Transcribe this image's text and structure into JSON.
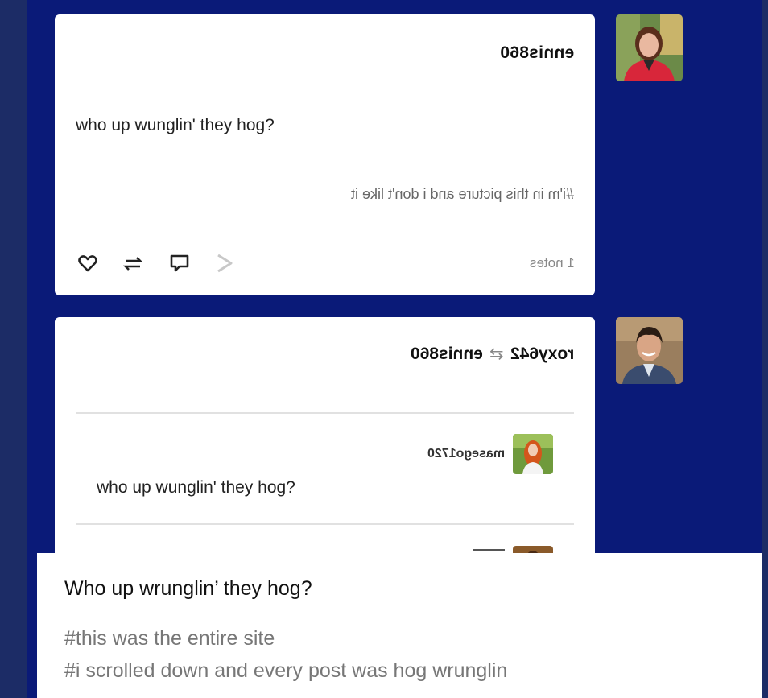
{
  "post1": {
    "username": "ennis860",
    "body": "who up wunglin' they hog?",
    "tags": "#i'm in this picture and i don't like it",
    "notes": "1 notes"
  },
  "post2": {
    "username": "roxy642",
    "reblog_from": "ennis860",
    "trail_username": "masego1720",
    "trail_body": "who up wunglin' they hog?"
  },
  "footer_icons": [
    "heart-icon",
    "reblog-icon",
    "reply-icon",
    "share-icon"
  ],
  "caption": {
    "title": "Who up wrunglin’ they hog?",
    "tags": [
      "#this was the entire site",
      "#i scrolled down and every post was hog wrunglin"
    ]
  },
  "colors": {
    "background": "#0a1a78",
    "rail": "#1c2c66",
    "card": "#ffffff",
    "tag_text": "#777777"
  }
}
